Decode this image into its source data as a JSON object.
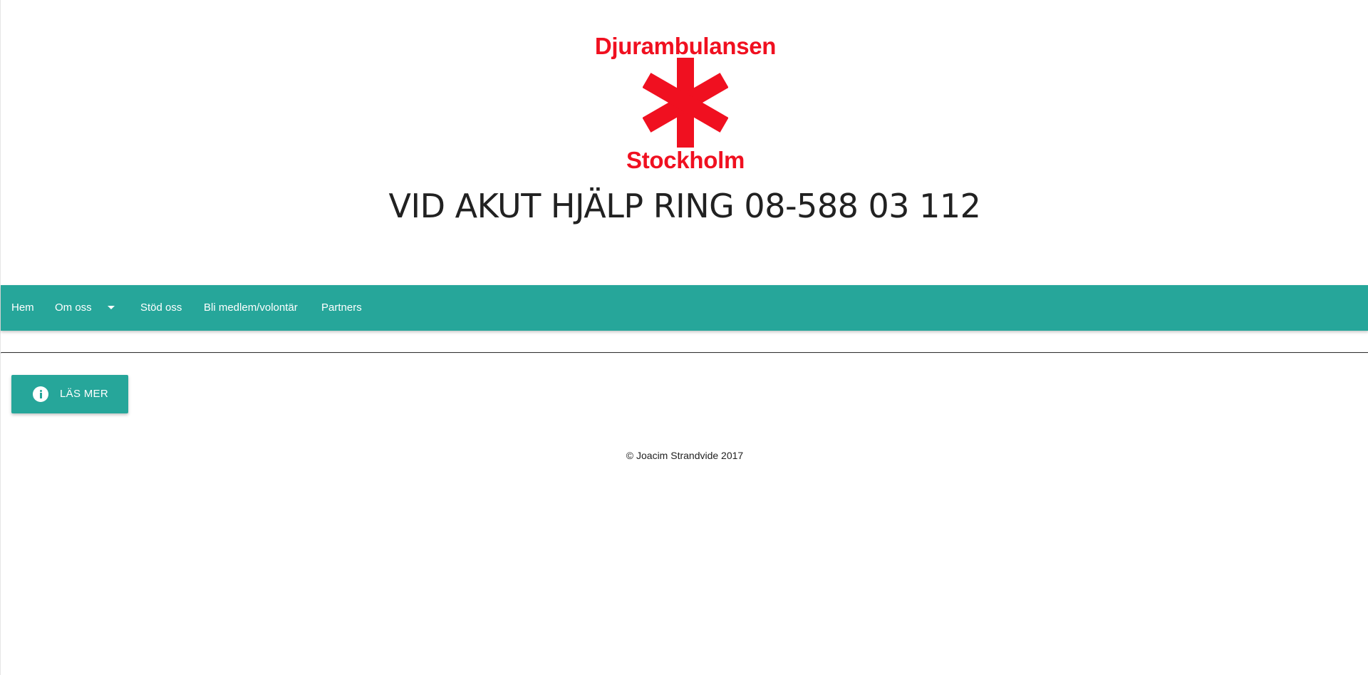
{
  "logo": {
    "top_text": "Djurambulansen",
    "bottom_text": "Stockholm",
    "icon": "star-of-life-icon",
    "color": "#f01020"
  },
  "header": {
    "headline": "VID AKUT HJÄLP RING 08-588 03 112"
  },
  "nav": {
    "background": "#26a69a",
    "items": [
      {
        "label": "Hem"
      },
      {
        "label": "Om oss",
        "icon": "arrow-drop-down-icon"
      },
      {
        "label": "Stöd oss"
      },
      {
        "label": "Bli medlem/volontär"
      },
      {
        "label": "Partners"
      }
    ]
  },
  "main": {
    "read_more_button": {
      "label": "LÄS MER",
      "icon": "info-icon"
    }
  },
  "footer": {
    "copyright": "© Joacim Strandvide 2017"
  }
}
